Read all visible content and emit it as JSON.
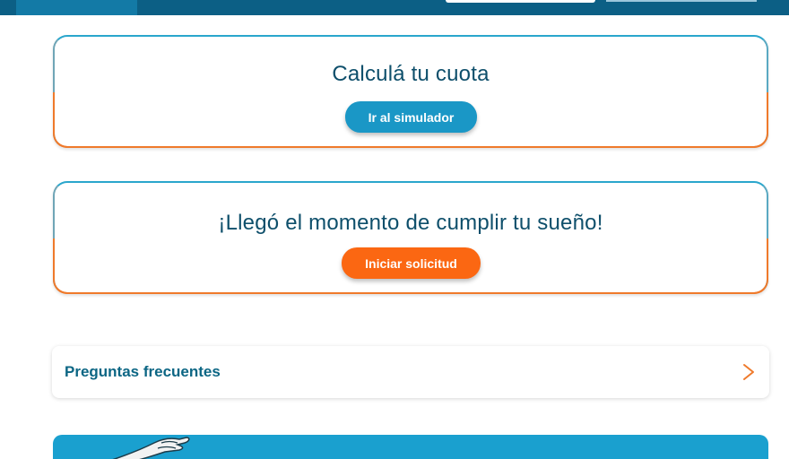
{
  "card_simulator": {
    "title": "Calculá tu cuota",
    "button_label": "Ir al simulador"
  },
  "card_request": {
    "title": "¡Llegó el momento de cumplir tu sueño!",
    "button_label": "Iniciar solicitud"
  },
  "faq": {
    "label": "Preguntas frecuentes",
    "icon": "chevron-right-icon"
  },
  "colors": {
    "brand_dark": "#0c5f85",
    "accent_blue": "#1a97c6",
    "accent_orange": "#fb6712",
    "title_text": "#0e4f6b",
    "banner": "#1aa0cf"
  }
}
